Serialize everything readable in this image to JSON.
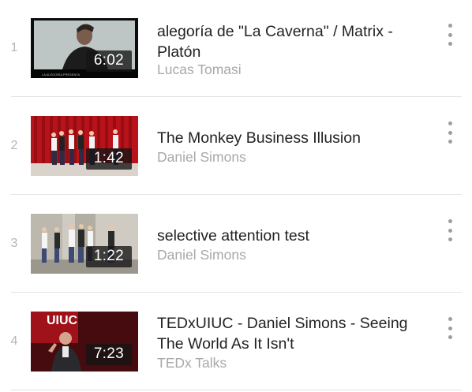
{
  "playlist": {
    "items": [
      {
        "index": "1",
        "title": "alegoría de \"La Caverna\" / Matrix - Platón",
        "channel": "Lucas Tomasi",
        "duration": "6:02",
        "thumbnail_icon": "video-thumbnail"
      },
      {
        "index": "2",
        "title": "The Monkey Business Illusion",
        "channel": "Daniel Simons",
        "duration": "1:42",
        "thumbnail_icon": "video-thumbnail"
      },
      {
        "index": "3",
        "title": "selective attention test",
        "channel": "Daniel Simons",
        "duration": "1:22",
        "thumbnail_icon": "video-thumbnail"
      },
      {
        "index": "4",
        "title": "TEDxUIUC - Daniel Simons - Seeing The World As It Isn't",
        "channel": "TEDx Talks",
        "duration": "7:23",
        "thumbnail_icon": "video-thumbnail"
      }
    ],
    "thumb1_caption": "LA ALEGORÍA PRESENTA",
    "thumb4_logo": "UIUC",
    "colors": {
      "title": "#222222",
      "secondary": "#a8a8a8",
      "index": "#b5b5b5",
      "divider": "#e3e3e3"
    }
  }
}
